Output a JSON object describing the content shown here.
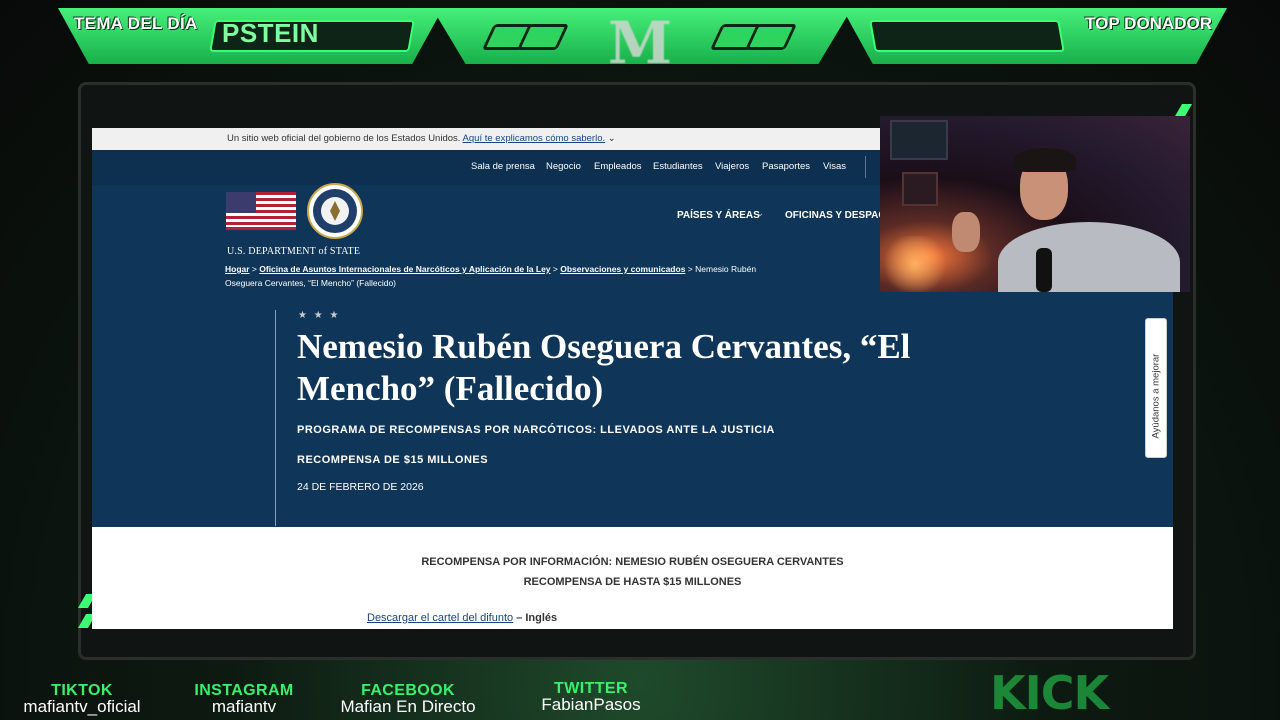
{
  "overlay": {
    "topic_label": "TEMA DEL DÍA",
    "topic_text": "PSTEIN",
    "donor_label": "TOP DONADOR",
    "logo_letter": "M",
    "kick_logo": "KICK"
  },
  "socials": [
    {
      "name": "TIKTOK",
      "handle": "mafiantv_oficial"
    },
    {
      "name": "INSTAGRAM",
      "handle": "mafiantv"
    },
    {
      "name": "FACEBOOK",
      "handle": "Mafian En Directo"
    },
    {
      "name": "TWITTER",
      "handle": "FabianPasos"
    }
  ],
  "site": {
    "banner_text": "Un sitio web oficial del gobierno de los Estados Unidos.",
    "banner_link": "Aquí te explicamos cómo saberlo.",
    "department": "U.S. DEPARTMENT of STATE",
    "top_nav": [
      "Sala de prensa",
      "Negocio",
      "Empleados",
      "Estudiantes",
      "Viajeros",
      "Pasaportes",
      "Visas"
    ],
    "main_nav": [
      "PAÍSES Y ÁREAS",
      "OFICINAS Y DESPAC"
    ],
    "breadcrumb": {
      "home": "Hogar",
      "office": "Oficina de Asuntos Internacionales de Narcóticos y Aplicación de la Ley",
      "section": "Observaciones y comunicados",
      "current": "Nemesio Rubén Oseguera Cervantes, “El Mencho” (Fallecido)"
    },
    "stars": "★ ★ ★",
    "title": "Nemesio Rubén Oseguera Cervantes, “El Mencho” (Fallecido)",
    "program": "PROGRAMA DE RECOMPENSAS POR NARCÓTICOS: LLEVADOS ANTE LA JUSTICIA",
    "reward": "RECOMPENSA DE $15 MILLONES",
    "date": "24 DE FEBRERO DE 2026",
    "feedback": "Ayúdanos a mejorar",
    "body_heading_1": "RECOMPENSA POR INFORMACIÓN: NEMESIO RUBÉN OSEGUERA CERVANTES",
    "body_heading_2": "RECOMPENSA DE HASTA $15 MILLONES",
    "download_link": "Descargar el cartel del difunto",
    "download_lang": "– Inglés"
  },
  "colors": {
    "accent_green": "#3cff74",
    "state_navy": "#0f3559",
    "link_blue": "#1a4480"
  }
}
